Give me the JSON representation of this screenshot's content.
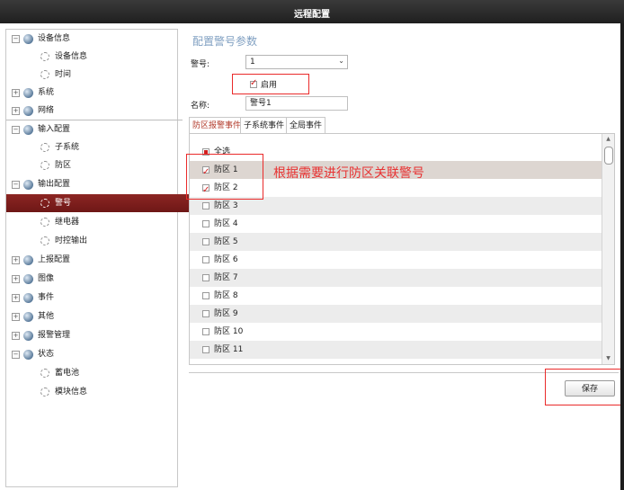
{
  "window": {
    "title": "远程配置"
  },
  "sidebar": {
    "items": [
      {
        "label": "设备信息",
        "expander": "−",
        "level": 0
      },
      {
        "label": "设备信息",
        "level": 1
      },
      {
        "label": "时间",
        "level": 1
      },
      {
        "label": "系统",
        "expander": "+",
        "level": 0
      },
      {
        "label": "网络",
        "expander": "+",
        "level": 0
      },
      {
        "label": "输入配置",
        "expander": "−",
        "level": 0
      },
      {
        "label": "子系统",
        "level": 1
      },
      {
        "label": "防区",
        "level": 1
      },
      {
        "label": "输出配置",
        "expander": "−",
        "level": 0
      },
      {
        "label": "警号",
        "level": 1,
        "active": true
      },
      {
        "label": "继电器",
        "level": 1
      },
      {
        "label": "时控输出",
        "level": 1
      },
      {
        "label": "上报配置",
        "expander": "+",
        "level": 0
      },
      {
        "label": "图像",
        "expander": "+",
        "level": 0
      },
      {
        "label": "事件",
        "expander": "+",
        "level": 0
      },
      {
        "label": "其他",
        "expander": "+",
        "level": 0
      },
      {
        "label": "报警管理",
        "expander": "+",
        "level": 0
      },
      {
        "label": "状态",
        "expander": "−",
        "level": 0
      },
      {
        "label": "蓄电池",
        "level": 1
      },
      {
        "label": "模块信息",
        "level": 1
      }
    ]
  },
  "main": {
    "section_title": "配置警号参数",
    "siren_label": "警号:",
    "siren_value": "1",
    "dropdown_icon": "chevron-down-icon",
    "enable_label": "启用",
    "enable_checked": true,
    "name_label": "名称:",
    "name_value": "警号1",
    "tabs": [
      {
        "label": "防区报警事件",
        "active": true
      },
      {
        "label": "子系统事件",
        "active": false
      },
      {
        "label": "全局事件",
        "active": false
      }
    ],
    "zone_rows": [
      {
        "label": "全选",
        "state": "partial"
      },
      {
        "label": "防区 1",
        "state": "checked"
      },
      {
        "label": "防区 2",
        "state": "checked"
      },
      {
        "label": "防区 3",
        "state": "unchecked"
      },
      {
        "label": "防区 4",
        "state": "unchecked"
      },
      {
        "label": "防区 5",
        "state": "unchecked"
      },
      {
        "label": "防区 6",
        "state": "unchecked"
      },
      {
        "label": "防区 7",
        "state": "unchecked"
      },
      {
        "label": "防区 8",
        "state": "unchecked"
      },
      {
        "label": "防区 9",
        "state": "unchecked"
      },
      {
        "label": "防区 10",
        "state": "unchecked"
      },
      {
        "label": "防区 11",
        "state": "unchecked"
      }
    ],
    "annotation_text": "根据需要进行防区关联警号",
    "save_label": "保存"
  },
  "colors": {
    "active_item": "#7d1f1d",
    "section_title": "#7f9fc1",
    "annotation": "#ea2a2a"
  }
}
